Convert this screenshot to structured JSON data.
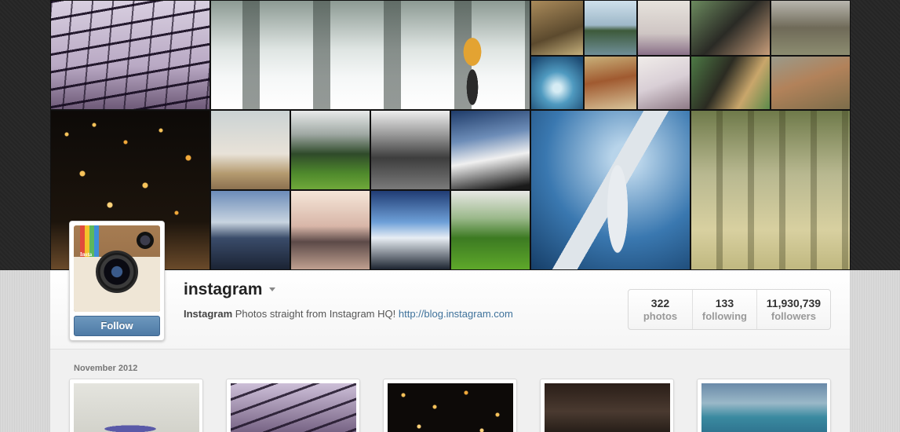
{
  "profile": {
    "username": "instagram",
    "full_name": "Instagram",
    "bio": "Photos straight from Instagram HQ!",
    "website": "http://blog.instagram.com",
    "follow_label": "Follow",
    "avatar_brand": "Insta"
  },
  "stats": [
    {
      "number": "322",
      "label": "photos"
    },
    {
      "number": "133",
      "label": "following"
    },
    {
      "number": "11,930,739",
      "label": "followers"
    }
  ],
  "feed": {
    "month_label": "November 2012"
  },
  "colors": {
    "follow_button": "#5b87b1",
    "link": "#3f729b",
    "header_band": "#262626"
  },
  "icons": {
    "username_menu": "caret-down-icon"
  }
}
